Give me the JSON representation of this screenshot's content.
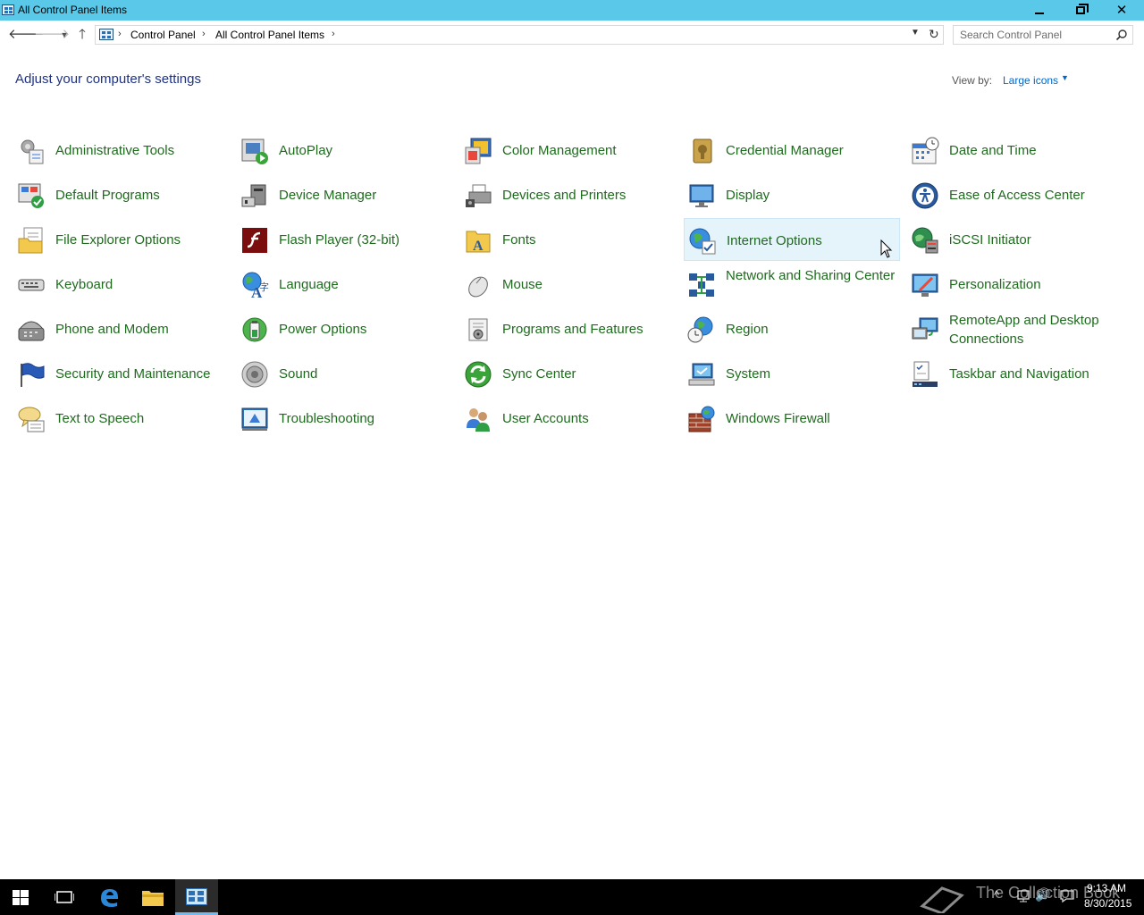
{
  "window": {
    "title": "All Control Panel Items"
  },
  "nav": {
    "breadcrumb": [
      "Control Panel",
      "All Control Panel Items"
    ],
    "search_placeholder": "Search Control Panel"
  },
  "header": {
    "heading": "Adjust your computer's settings",
    "view_by_label": "View by:",
    "view_by_value": "Large icons"
  },
  "items": [
    {
      "label": "Administrative Tools",
      "icon": "administrative-tools-icon"
    },
    {
      "label": "AutoPlay",
      "icon": "autoplay-icon"
    },
    {
      "label": "Color Management",
      "icon": "color-management-icon"
    },
    {
      "label": "Credential Manager",
      "icon": "credential-manager-icon"
    },
    {
      "label": "Date and Time",
      "icon": "date-time-icon"
    },
    {
      "label": "Default Programs",
      "icon": "default-programs-icon"
    },
    {
      "label": "Device Manager",
      "icon": "device-manager-icon"
    },
    {
      "label": "Devices and Printers",
      "icon": "devices-printers-icon"
    },
    {
      "label": "Display",
      "icon": "display-icon"
    },
    {
      "label": "Ease of Access Center",
      "icon": "ease-of-access-icon"
    },
    {
      "label": "File Explorer Options",
      "icon": "file-explorer-options-icon"
    },
    {
      "label": "Flash Player (32-bit)",
      "icon": "flash-player-icon"
    },
    {
      "label": "Fonts",
      "icon": "fonts-icon"
    },
    {
      "label": "Internet Options",
      "icon": "internet-options-icon"
    },
    {
      "label": "iSCSI Initiator",
      "icon": "iscsi-initiator-icon"
    },
    {
      "label": "Keyboard",
      "icon": "keyboard-icon"
    },
    {
      "label": "Language",
      "icon": "language-icon"
    },
    {
      "label": "Mouse",
      "icon": "mouse-icon"
    },
    {
      "label": "Network and Sharing Center",
      "icon": "network-sharing-icon"
    },
    {
      "label": "Personalization",
      "icon": "personalization-icon"
    },
    {
      "label": "Phone and Modem",
      "icon": "phone-modem-icon"
    },
    {
      "label": "Power Options",
      "icon": "power-options-icon"
    },
    {
      "label": "Programs and Features",
      "icon": "programs-features-icon"
    },
    {
      "label": "Region",
      "icon": "region-icon"
    },
    {
      "label": "RemoteApp and Desktop Connections",
      "icon": "remoteapp-icon"
    },
    {
      "label": "Security and Maintenance",
      "icon": "security-maintenance-icon"
    },
    {
      "label": "Sound",
      "icon": "sound-icon"
    },
    {
      "label": "Sync Center",
      "icon": "sync-center-icon"
    },
    {
      "label": "System",
      "icon": "system-icon"
    },
    {
      "label": "Taskbar and Navigation",
      "icon": "taskbar-navigation-icon"
    },
    {
      "label": "Text to Speech",
      "icon": "text-to-speech-icon"
    },
    {
      "label": "Troubleshooting",
      "icon": "troubleshooting-icon"
    },
    {
      "label": "User Accounts",
      "icon": "user-accounts-icon"
    },
    {
      "label": "Windows Firewall",
      "icon": "windows-firewall-icon"
    }
  ],
  "taskbar": {
    "watermark": "The Collection Book",
    "time": "9:13 AM",
    "date": "8/30/2015"
  },
  "colors": {
    "titlebar": "#5ac8e8",
    "link_green": "#1e6b1e",
    "heading_blue": "#1e3287",
    "hover_bg": "#e5f3fb"
  }
}
